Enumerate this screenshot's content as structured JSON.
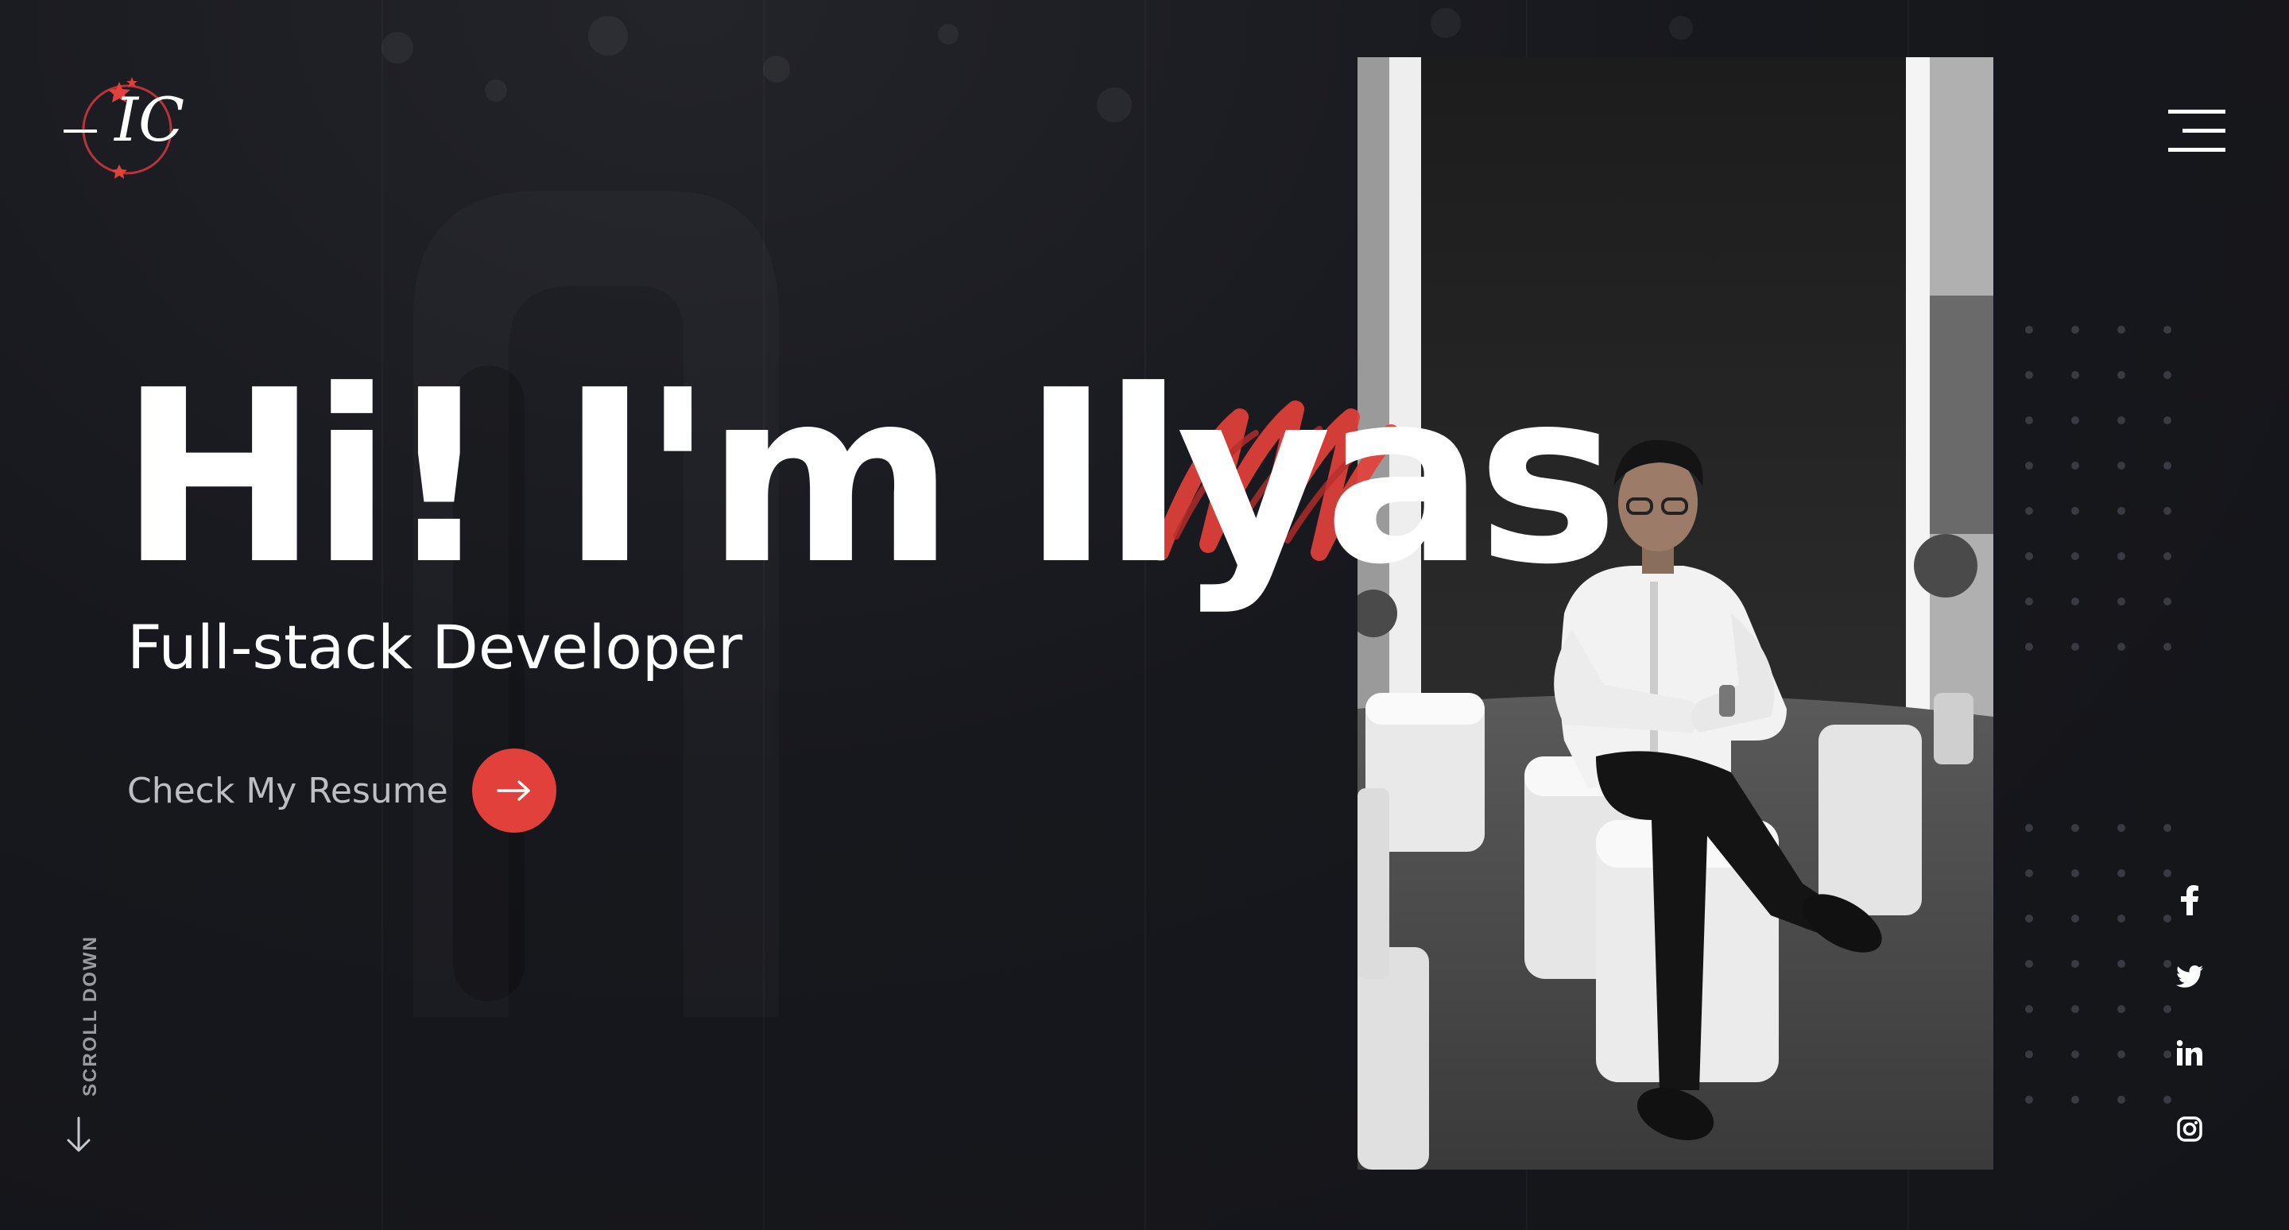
{
  "logo": {
    "text": "IC"
  },
  "hero": {
    "heading": "Hi! I'm Ilyas",
    "subtitle": "Full-stack Developer",
    "cta_label": "Check My Resume"
  },
  "scroll": {
    "label": "SCROLL DOWN"
  },
  "social": [
    {
      "icon": "facebook-icon"
    },
    {
      "icon": "twitter-icon"
    },
    {
      "icon": "linkedin-icon"
    },
    {
      "icon": "instagram-icon"
    }
  ],
  "colors": {
    "background": "#17181d",
    "accent": "#e2403b",
    "text": "#ffffff",
    "muted": "#bdbec3"
  }
}
